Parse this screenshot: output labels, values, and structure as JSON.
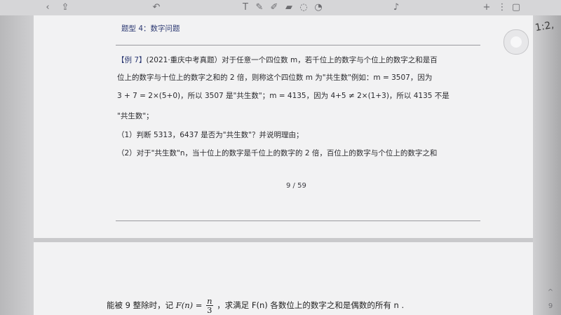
{
  "toolbar": {
    "icons": [
      "chevron-left-icon",
      "share-icon",
      "undo-icon",
      "text-tool-icon",
      "pen-icon",
      "highlighter-icon",
      "eraser-icon",
      "lasso-icon",
      "shapes-icon",
      "microphone-icon",
      "add-page-icon",
      "pages-icon",
      "more-icon"
    ]
  },
  "section": {
    "title": "题型 4：数字问题"
  },
  "problem": {
    "label": "【例 7】",
    "line1": "(2021·重庆中考真题）对于任意一个四位数 m，若千位上的数字与个位上的数字之和是百",
    "line2": "位上的数字与十位上的数字之和的 2 倍，则称这个四位数 m 为\"共生数\"例如：m = 3507，因为",
    "line3": "3 + 7 = 2×(5+0)，所以 3507 是\"共生数\"；m = 4135，因为 4+5 ≠ 2×(1+3)，所以 4135 不是",
    "line4": "\"共生数\"；",
    "q1": "（1）判断 5313，6437 是否为\"共生数\"？并说明理由；",
    "q2": "（2）对于\"共生数\"n，当十位上的数字是千位上的数字的 2 倍，百位上的数字与个位上的数字之和"
  },
  "pager": {
    "text": "9 / 59"
  },
  "continuation": {
    "prefix": "能被 9 整除时，记",
    "func": "F(n) =",
    "frac_num": "n",
    "frac_den": "3",
    "suffix": "，求满足 F(n) 各数位上的数字之和是偶数的所有 n ."
  },
  "right_edge": {
    "page_indicator": "9",
    "up_arrow": "^"
  },
  "scribble": "1:2,"
}
